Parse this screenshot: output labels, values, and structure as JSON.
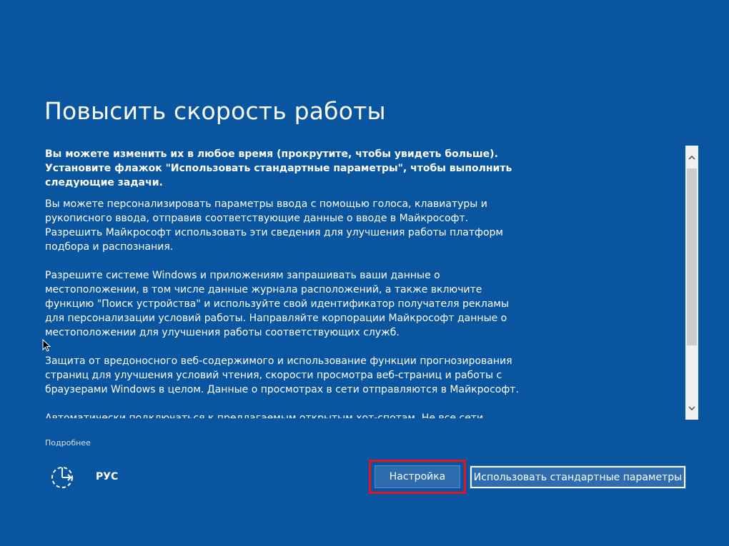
{
  "page": {
    "title": "Повысить скорость работы"
  },
  "content": {
    "intro": "Вы можете изменить их в любое время (прокрутите, чтобы увидеть больше). Установите флажок \"Использовать стандартные параметры\", чтобы выполнить следующие задачи.",
    "paragraphs": [
      "Вы можете персонализировать параметры ввода с помощью голоса, клавиатуры и рукописного ввода, отправив соответствующие данные о вводе в Майкрософт. Разрешить Майкрософт использовать эти сведения для улучшения работы платформ подбора и распознания.",
      "Разрешите системе Windows и приложениям запрашивать ваши данные о местоположении, в том числе данные журнала расположений, а также включите функцию \"Поиск устройства\" и используйте свой идентификатор получателя рекламы для персонализации условий работы. Направляйте корпорации Майкрософт данные о местоположении для улучшения работы соответствующих служб.",
      "Защита от вредоносного веб-содержимого и использование функции прогнозирования страниц для улучшения условий чтения, скорости просмотра веб-страниц и работы с браузерами Windows в целом. Данные о просмотрах в сети отправляются в Майкрософт.",
      "Автоматически подключаться к предлагаемым открытым хот-спотам. Не все сети безопасны."
    ]
  },
  "footer": {
    "more_link": "Подробнее",
    "language": "РУС",
    "accessibility_icon": "ease-of-access-icon"
  },
  "buttons": {
    "customize": "Настройка",
    "use_default": "Использовать стандартные параметры"
  },
  "colors": {
    "background": "#0a559f",
    "button": "#2d6cae",
    "highlight": "#e81123"
  }
}
